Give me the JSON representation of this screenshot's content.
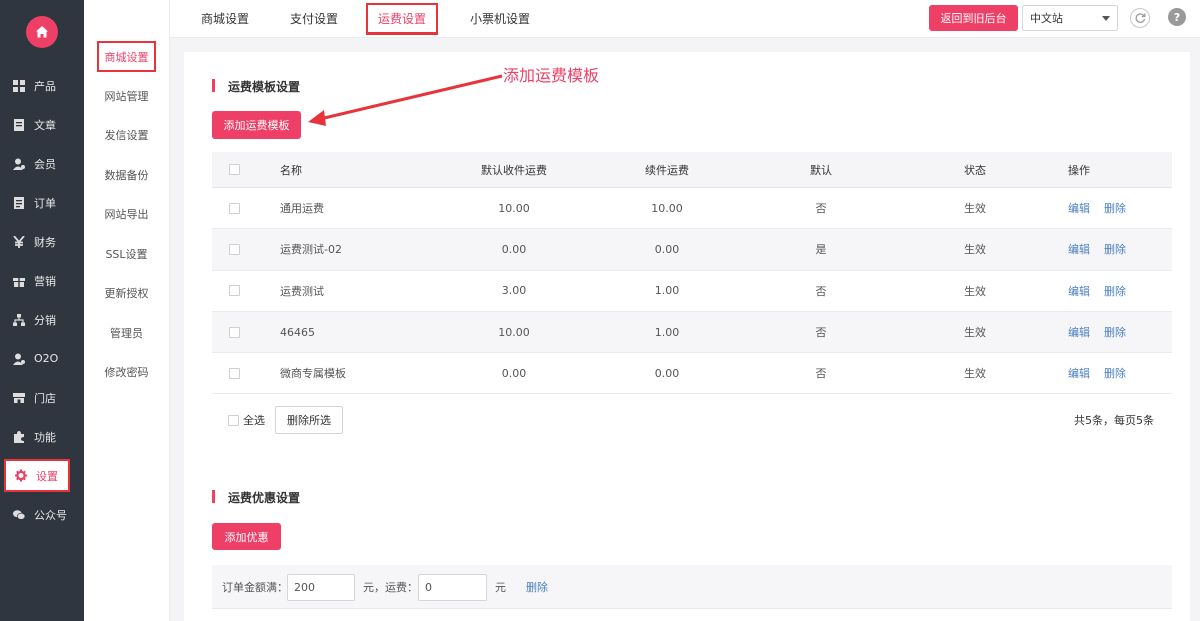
{
  "sidebar": {
    "items": [
      {
        "label": "产品",
        "icon": "grid-icon"
      },
      {
        "label": "文章",
        "icon": "document-icon"
      },
      {
        "label": "会员",
        "icon": "member-icon"
      },
      {
        "label": "订单",
        "icon": "order-icon"
      },
      {
        "label": "财务",
        "icon": "yen-icon"
      },
      {
        "label": "营销",
        "icon": "gift-icon"
      },
      {
        "label": "分销",
        "icon": "sitemap-icon"
      },
      {
        "label": "O2O",
        "icon": "o2o-icon"
      },
      {
        "label": "门店",
        "icon": "store-icon"
      },
      {
        "label": "功能",
        "icon": "puzzle-icon"
      },
      {
        "label": "设置",
        "icon": "gear-icon"
      },
      {
        "label": "公众号",
        "icon": "wechat-icon"
      }
    ],
    "active_index": 10
  },
  "subnav": {
    "items": [
      "商城设置",
      "网站管理",
      "发信设置",
      "数据备份",
      "网站导出",
      "SSL设置",
      "更新授权",
      "管理员",
      "修改密码"
    ],
    "active_index": 0
  },
  "topbar": {
    "tabs": [
      "商城设置",
      "支付设置",
      "运费设置",
      "小票机设置"
    ],
    "active_index": 2,
    "back_label": "返回到旧后台",
    "language_value": "中文站"
  },
  "annotation": "添加运费模板",
  "shipping_template": {
    "title": "运费模板设置",
    "add_label": "添加运费模板",
    "columns": [
      "名称",
      "默认收件运费",
      "续件运费",
      "默认",
      "状态",
      "操作"
    ],
    "rows": [
      {
        "name": "通用运费",
        "first_fee": "10.00",
        "extra_fee": "10.00",
        "is_default": "否",
        "status": "生效"
      },
      {
        "name": "运费测试-02",
        "first_fee": "0.00",
        "extra_fee": "0.00",
        "is_default": "是",
        "status": "生效"
      },
      {
        "name": "运费测试",
        "first_fee": "3.00",
        "extra_fee": "1.00",
        "is_default": "否",
        "status": "生效"
      },
      {
        "name": "46465",
        "first_fee": "10.00",
        "extra_fee": "1.00",
        "is_default": "否",
        "status": "生效"
      },
      {
        "name": "微商专属模板",
        "first_fee": "0.00",
        "extra_fee": "0.00",
        "is_default": "否",
        "status": "生效"
      }
    ],
    "edit_label": "编辑",
    "delete_label": "删除",
    "select_all_label": "全选",
    "delete_selected_label": "删除所选",
    "summary": "共5条，每页5条"
  },
  "discount": {
    "title": "运费优惠设置",
    "add_label": "添加优惠",
    "order_label": "订单金额满：",
    "order_value": "200",
    "middle_label": "元，运费：",
    "fee_value": "0",
    "unit_label": "元",
    "delete_label": "删除"
  },
  "colors": {
    "accent": "#ee3f67",
    "sidebar_bg": "#2f3640",
    "link": "#4a7fc1",
    "highlight_border": "#e8333a"
  }
}
